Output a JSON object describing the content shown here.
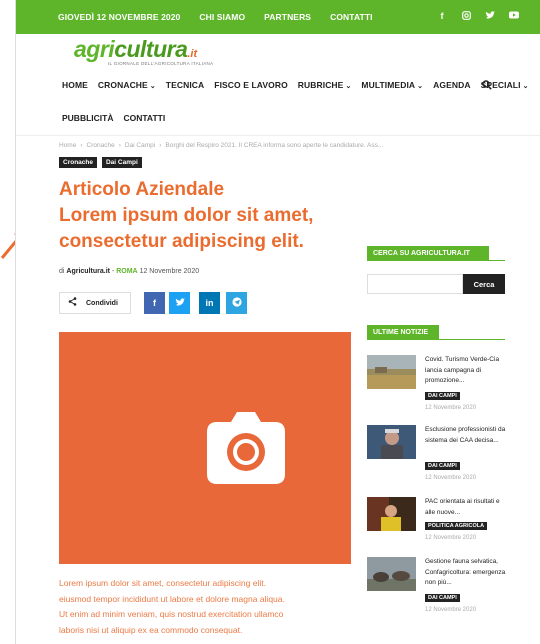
{
  "topbar": {
    "date": "GIOVEDÌ 12 NOVEMBRE 2020",
    "links": [
      "CHI SIAMO",
      "PARTNERS",
      "CONTATTI"
    ],
    "social_icons": [
      "facebook-icon",
      "instagram-icon",
      "twitter-icon",
      "youtube-icon"
    ],
    "color": "#5eb52a"
  },
  "logo": {
    "part1": "agri",
    "part2": "cultura",
    "suffix": ".it",
    "tagline": "IL GIORNALE DELL'AGRICOLTURA ITALIANA"
  },
  "nav": {
    "items": [
      {
        "label": "HOME",
        "dropdown": false
      },
      {
        "label": "CRONACHE",
        "dropdown": true
      },
      {
        "label": "TECNICA",
        "dropdown": false
      },
      {
        "label": "FISCO E LAVORO",
        "dropdown": false
      },
      {
        "label": "RUBRICHE",
        "dropdown": true
      },
      {
        "label": "MULTIMEDIA",
        "dropdown": true
      },
      {
        "label": "AGENDA",
        "dropdown": false
      },
      {
        "label": "SPECIALI",
        "dropdown": true
      }
    ],
    "items_row2": [
      "PUBBLICITÀ",
      "CONTATTI"
    ],
    "caret": "⌄"
  },
  "breadcrumb": [
    "Home",
    "Cronache",
    "Dai Campi",
    "Borghi del Respiro 2021. Il CREA informa sono aperte le candidature. Ass..."
  ],
  "categories": [
    "Cronache",
    "Dai Campi"
  ],
  "article": {
    "title_lines": [
      "Articolo Aziendale",
      "Lorem ipsum dolor sit amet,",
      "consectetur adipiscing elit."
    ],
    "by_prefix": "di",
    "author": "Agricultura.it",
    "separator": "-",
    "city": "ROMA",
    "date": "12 Novembre 2020",
    "share_label": "Condividi",
    "share_buttons": [
      {
        "icon": "facebook-icon",
        "glyph": "f",
        "color": "#4267b2"
      },
      {
        "icon": "twitter-icon",
        "glyph": "🐦",
        "color": "#1da1f2"
      },
      {
        "icon": "linkedin-icon",
        "glyph": "in",
        "color": "#0077b5"
      },
      {
        "icon": "telegram-icon",
        "glyph": "➤",
        "color": "#2ca5e0"
      }
    ],
    "hero_color": "#e8683a",
    "body_lines": [
      "Lorem ipsum dolor sit amet, consectetur adipiscing elit.",
      "eiusmod tempor incididunt ut labore et dolore magna aliqua.",
      "Ut enim ad minim veniam, quis nostrud exercitation ullamco",
      "laboris nisi ut aliquip ex ea commodo consequat."
    ]
  },
  "sidebar": {
    "search_heading": "CERCA SU AGRICULTURA.IT",
    "search_placeholder": "",
    "search_button": "Cerca",
    "news_heading": "ULTIME NOTIZIE",
    "news": [
      {
        "title": "Covid. Turismo Verde-Cia lancia campagna di promozione...",
        "category": "DAI CAMPI",
        "date": "12 Novembre 2020"
      },
      {
        "title": "Esclusione professionisti da sistema dei CAA decisa...",
        "category": "DAI CAMPI",
        "date": "12 Novembre 2020"
      },
      {
        "title": "PAC orientata ai risultati e alle nuove...",
        "category": "POLITICA AGRICOLA",
        "date": "12 Novembre 2020"
      },
      {
        "title": "Gestione fauna selvatica, Confagricoltura: emergenza non più...",
        "category": "DAI CAMPI",
        "date": "12 Novembre 2020"
      }
    ]
  }
}
